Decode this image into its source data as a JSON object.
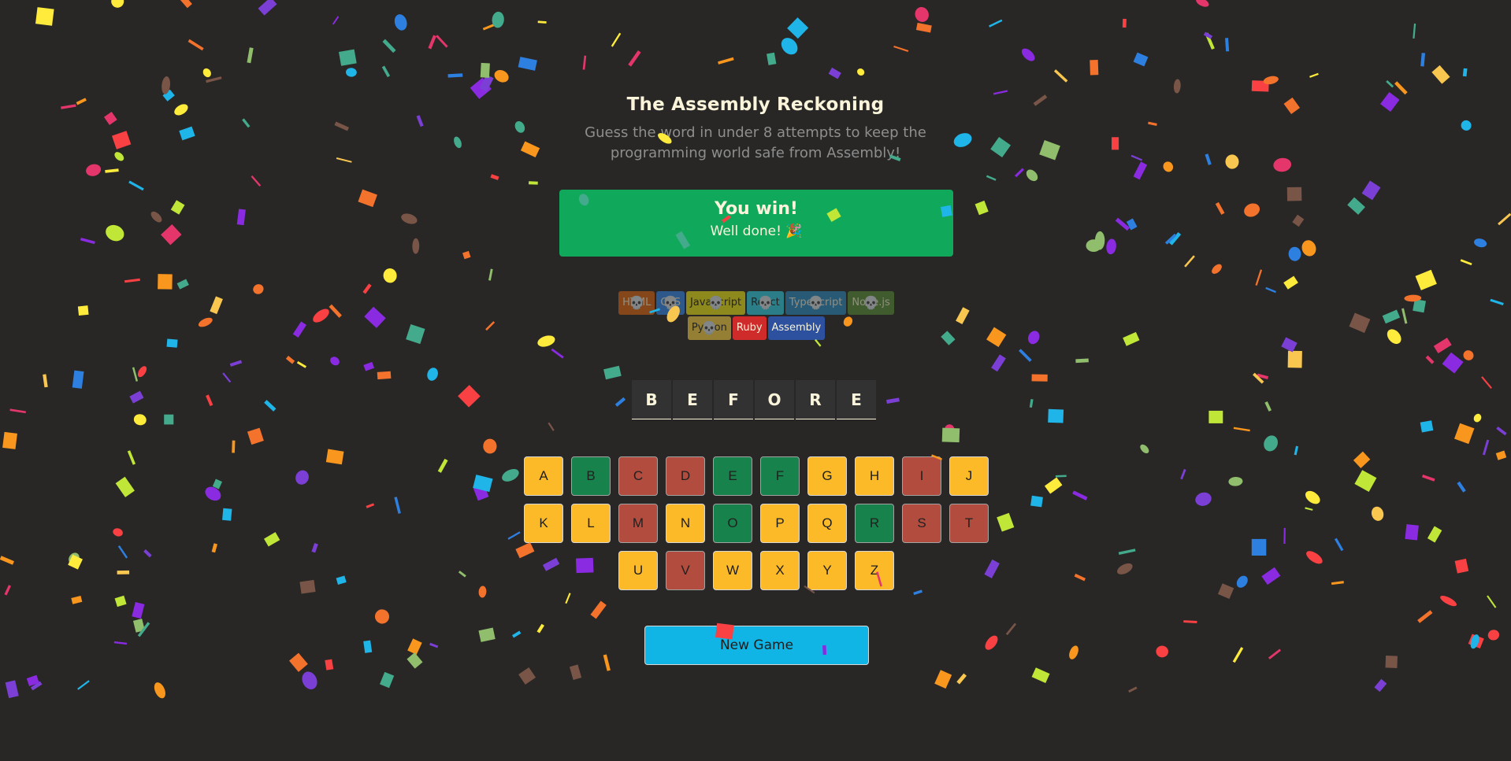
{
  "header": {
    "title": "The Assembly Reckoning",
    "subtitle": "Guess the word in under 8 attempts to keep the programming world safe from Assembly!"
  },
  "status": {
    "title": "You win!",
    "message": "Well done! 🎉",
    "color": "#10a95b"
  },
  "languages": [
    {
      "name": "HTML",
      "bg": "#E2680F",
      "fg": "#F9F4DA",
      "lost": true
    },
    {
      "name": "CSS",
      "bg": "#328AF1",
      "fg": "#F9F4DA",
      "lost": true
    },
    {
      "name": "JavaScript",
      "bg": "#F4EB13",
      "fg": "#1E1E1E",
      "lost": true
    },
    {
      "name": "React",
      "bg": "#2ED3E9",
      "fg": "#1E1E1E",
      "lost": true
    },
    {
      "name": "TypeScript",
      "bg": "#298EC6",
      "fg": "#F9F4DA",
      "lost": true
    },
    {
      "name": "Node.js",
      "bg": "#599137",
      "fg": "#F9F4DA",
      "lost": true
    },
    {
      "name": "Python",
      "bg": "#FFD742",
      "fg": "#1E1E1E",
      "lost": true
    },
    {
      "name": "Ruby",
      "bg": "#D02B2B",
      "fg": "#F9F4DA",
      "lost": false
    },
    {
      "name": "Assembly",
      "bg": "#2D519F",
      "fg": "#F9F4DA",
      "lost": false
    }
  ],
  "skull_icon": "skull-icon",
  "word": [
    "B",
    "E",
    "F",
    "O",
    "R",
    "E"
  ],
  "keyboard": [
    {
      "letter": "A",
      "state": "unused"
    },
    {
      "letter": "B",
      "state": "correct"
    },
    {
      "letter": "C",
      "state": "wrong"
    },
    {
      "letter": "D",
      "state": "wrong"
    },
    {
      "letter": "E",
      "state": "correct"
    },
    {
      "letter": "F",
      "state": "correct"
    },
    {
      "letter": "G",
      "state": "unused"
    },
    {
      "letter": "H",
      "state": "unused"
    },
    {
      "letter": "I",
      "state": "wrong"
    },
    {
      "letter": "J",
      "state": "unused"
    },
    {
      "letter": "K",
      "state": "unused"
    },
    {
      "letter": "L",
      "state": "unused"
    },
    {
      "letter": "M",
      "state": "wrong"
    },
    {
      "letter": "N",
      "state": "unused"
    },
    {
      "letter": "O",
      "state": "correct"
    },
    {
      "letter": "P",
      "state": "unused"
    },
    {
      "letter": "Q",
      "state": "unused"
    },
    {
      "letter": "R",
      "state": "correct"
    },
    {
      "letter": "S",
      "state": "wrong"
    },
    {
      "letter": "T",
      "state": "wrong"
    },
    {
      "letter": "U",
      "state": "unused"
    },
    {
      "letter": "V",
      "state": "wrong"
    },
    {
      "letter": "W",
      "state": "unused"
    },
    {
      "letter": "X",
      "state": "unused"
    },
    {
      "letter": "Y",
      "state": "unused"
    },
    {
      "letter": "Z",
      "state": "unused"
    }
  ],
  "new_game_label": "New Game",
  "confetti_colors": [
    "#f94144",
    "#f3722c",
    "#f8961e",
    "#f9c74f",
    "#90be6d",
    "#43aa8b",
    "#1fb5e9",
    "#2d7fe0",
    "#7b3fd6",
    "#e5366b",
    "#795548",
    "#c0e637",
    "#ffeb3b",
    "#8a2be2"
  ]
}
